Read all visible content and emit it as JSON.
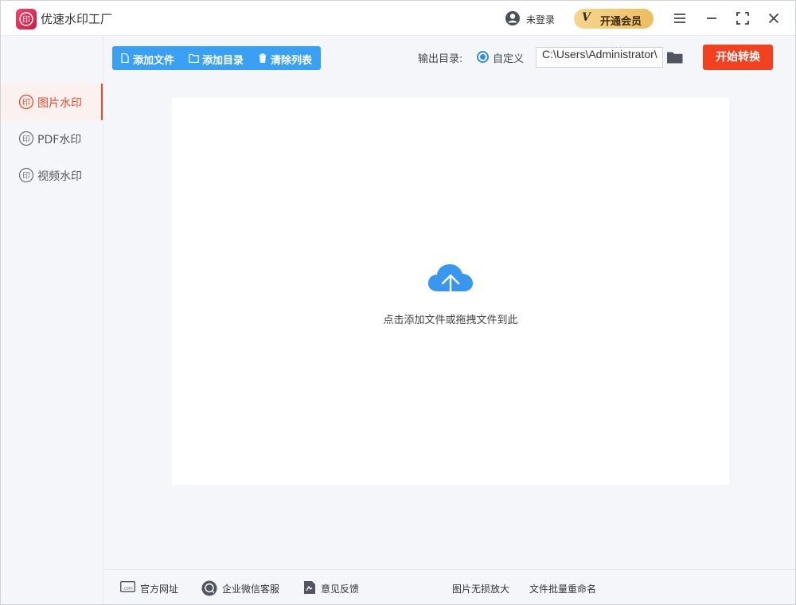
{
  "app": {
    "title": "优速水印工厂",
    "login_text": "未登录",
    "vip_label": "开通会员",
    "vip_icon_text": "V"
  },
  "sidebar": {
    "items": [
      {
        "label": "图片水印",
        "active": true
      },
      {
        "label": "PDF水印",
        "active": false
      },
      {
        "label": "视频水印",
        "active": false
      }
    ]
  },
  "toolbar": {
    "add_file": "添加文件",
    "add_dir": "添加目录",
    "clear_list": "清除列表",
    "output_label": "输出目录:",
    "radio_label": "自定义",
    "output_path": "C:\\Users\\Administrator\\",
    "start": "开始转换"
  },
  "drop": {
    "hint": "点击添加文件或拖拽文件到此"
  },
  "footer": {
    "website": "官方网址",
    "wechat": "企业微信客服",
    "feedback": "意见反馈",
    "enlarge": "图片无损放大",
    "rename": "文件批量重命名"
  },
  "colors": {
    "accent_blue": "#3aa0f3",
    "start_red": "#f1411f",
    "active_red": "#e84a2f",
    "vip_gold": "#edbd5e"
  },
  "icons": [
    "app-logo-icon",
    "user-icon",
    "menu-icon",
    "minimize-icon",
    "maximize-icon",
    "close-icon",
    "stamp-icon",
    "file-icon",
    "folder-outline-icon",
    "trash-icon",
    "folder-icon",
    "cloud-upload-icon",
    "web-icon",
    "chat-icon",
    "document-icon"
  ]
}
